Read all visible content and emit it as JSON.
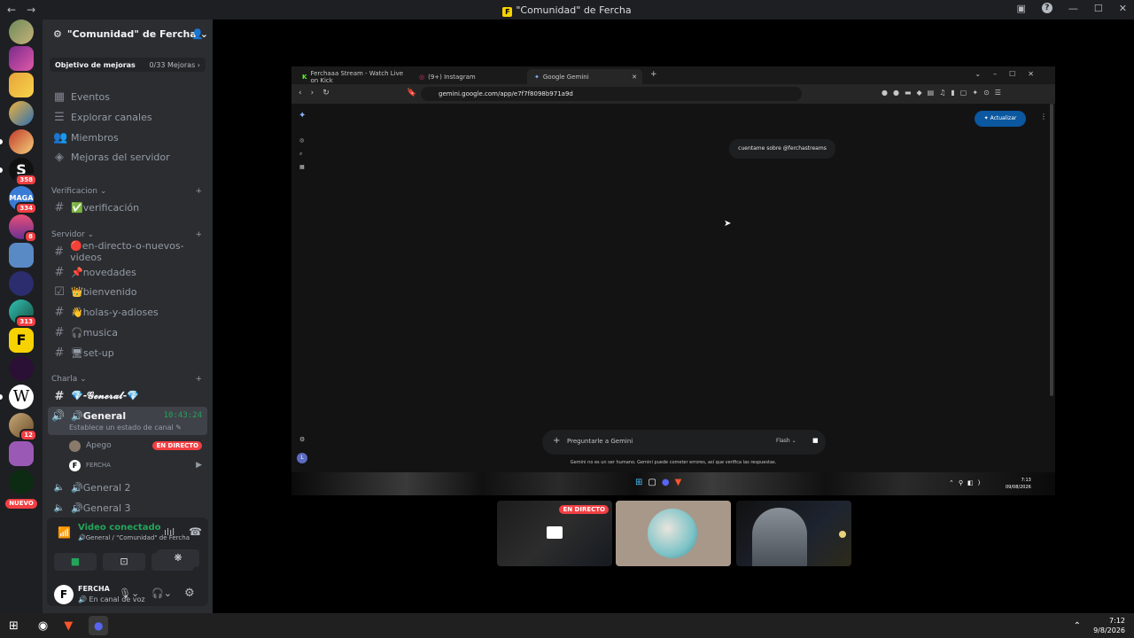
{
  "titlebar": {
    "title": "\"Comunidad\" de Fercha",
    "back": "←",
    "forward": "→"
  },
  "servers": {
    "badges": [
      "358",
      "334",
      "8",
      "313",
      "12"
    ],
    "new_label": "NUEVO"
  },
  "channels": {
    "server_name": "\"Comunidad\" de Fercha",
    "boost_goal": {
      "label": "Objetivo de mejoras",
      "progress": "0/33 Mejoras"
    },
    "quick": [
      {
        "label": "Eventos",
        "icon": "calendar-icon"
      },
      {
        "label": "Explorar canales",
        "icon": "list-icon"
      },
      {
        "label": "Miembros",
        "icon": "members-icon"
      },
      {
        "label": "Mejoras del servidor",
        "icon": "boost-icon"
      }
    ],
    "categories": {
      "verificacion": "Verificacion",
      "servidor": "Servidor",
      "charla": "Charla"
    },
    "verificacion_channels": [
      "✅verificación"
    ],
    "servidor_channels": [
      "🔴en-directo-o-nuevos-videos",
      "📌novedades",
      "👑bienvenido",
      "👋holas-y-adioses",
      "🎧musica",
      "🖥set-up"
    ],
    "charla_text": "💎-𝓖𝓮𝓷𝓮𝓻𝓪𝓵-💎",
    "voice_general": {
      "label": "🔊General",
      "timer": "10:43:24",
      "status": "Establece un estado de canal"
    },
    "voice_users": [
      {
        "name": "Apego",
        "badge": "EN DIRECTO"
      },
      {
        "name": "FERCHA"
      }
    ],
    "voice_other": [
      "🔊General 2",
      "🔊General 3"
    ]
  },
  "voicebar": {
    "status": "Video conectado",
    "channel": "🔊General / \"Comunidad\" de Fercha"
  },
  "user": {
    "name": "FERCHA",
    "status": "En canal de voz"
  },
  "browser": {
    "tabs": [
      "Ferchaaa Stream - Watch Live on Kick",
      "(9+) Instagram",
      "Google Gemini"
    ],
    "url": "gemini.google.com/app/e7f7f8098b971a9d",
    "update_button": "Actualizar",
    "chat_bubble": "cuentame sobre @ferchastreams",
    "prompt_placeholder": "Preguntarle a Gemini",
    "model": "Flash",
    "disclaimer": "Gemini no es un ser humano. Gemini puede cometer errores, así que verifica las respuestas.",
    "avatar_letter": "L",
    "clock_time": "7:13",
    "clock_date": "09/08/2026"
  },
  "thumbs": {
    "live_badge": "EN DIRECTO"
  },
  "taskbar": {
    "time": "7:12",
    "date": "9/8/2026"
  },
  "colors": {
    "accent": "#23a55a",
    "live": "#f23f43",
    "gemini_btn": "#0b57a0"
  }
}
